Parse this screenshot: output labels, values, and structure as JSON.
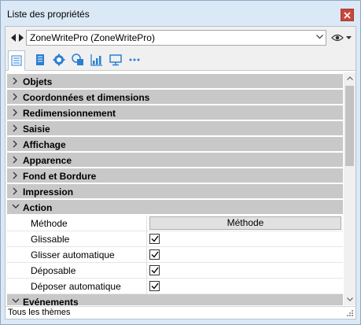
{
  "window": {
    "title": "Liste des propriétés"
  },
  "selector": {
    "value": "ZoneWritePro (ZoneWritePro)"
  },
  "tabs": [
    {
      "icon": "list-icon"
    },
    {
      "icon": "document-icon"
    },
    {
      "icon": "gear-icon"
    },
    {
      "icon": "shapes-icon"
    },
    {
      "icon": "chart-icon"
    },
    {
      "icon": "monitor-icon"
    },
    {
      "icon": "more-icon"
    }
  ],
  "categories_top": [
    "Objets",
    "Coordonnées et dimensions",
    "Redimensionnement",
    "Saisie",
    "Affichage",
    "Apparence",
    "Fond et Bordure",
    "Impression"
  ],
  "action": {
    "label": "Action",
    "method_label": "Méthode",
    "method_button": "Méthode",
    "props": [
      {
        "name": "Glissable",
        "checked": true
      },
      {
        "name": "Glisser automatique",
        "checked": true
      },
      {
        "name": "Déposable",
        "checked": true
      },
      {
        "name": "Déposer automatique",
        "checked": true
      }
    ]
  },
  "categories_bottom": [
    "Evénements"
  ],
  "status": {
    "text": "Tous les thèmes"
  },
  "colors": {
    "category_bg": "#c8c8c8",
    "close": "#c7483b",
    "frame": "#dbe8f5"
  }
}
